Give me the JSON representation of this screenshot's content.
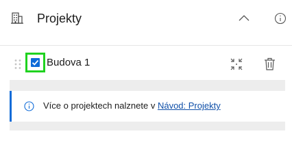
{
  "panel": {
    "title": "Projekty",
    "header_icon": "building-icon",
    "collapse_icon": "chevron-up-icon",
    "info_icon": "info-icon"
  },
  "items": [
    {
      "label": "Budova 1",
      "checked": true,
      "drag_icon": "drag-handle-icon",
      "zoom_icon": "zoom-to-icon",
      "delete_icon": "trash-icon"
    }
  ],
  "info_banner": {
    "icon": "info-icon",
    "text": "Více o projektech nalznete v",
    "link_text": "Návod: Projekty"
  },
  "colors": {
    "accent": "#0f6bd8",
    "highlight": "#1fd21f",
    "link": "#0f4fa8"
  }
}
